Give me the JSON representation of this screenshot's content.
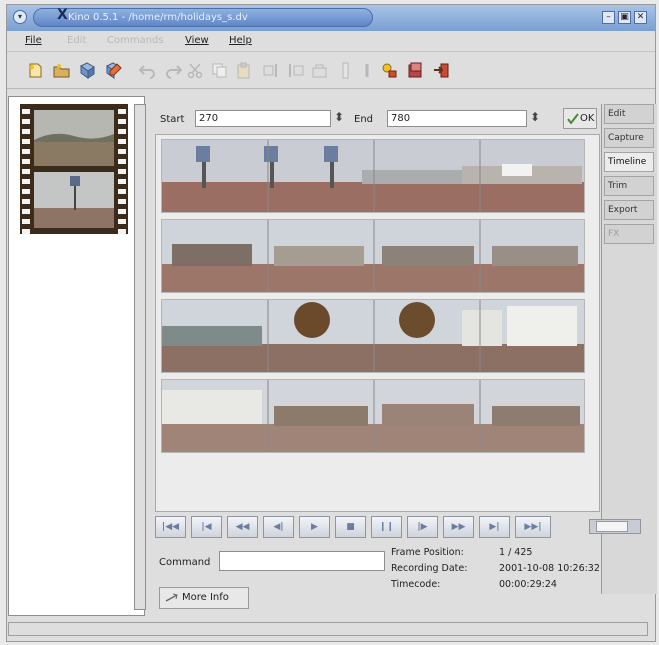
{
  "window": {
    "title": "Kino 0.5.1 - /home/rm/holidays_s.dv",
    "menu_glyph": "▾",
    "x_glyph": "X",
    "buttons": [
      "–",
      "▣",
      "✕"
    ]
  },
  "menubar": {
    "items": [
      {
        "label": "File",
        "enabled": true
      },
      {
        "label": "Edit",
        "enabled": false
      },
      {
        "label": "Commands",
        "enabled": false
      },
      {
        "label": "View",
        "enabled": true
      },
      {
        "label": "Help",
        "enabled": true
      }
    ]
  },
  "toolbar": {
    "icons": [
      "new-icon",
      "open-icon",
      "save-icon",
      "save-as-icon",
      "undo-icon",
      "redo-icon",
      "cut-icon",
      "copy-icon",
      "paste-icon",
      "insert-before-icon",
      "insert-after-icon",
      "append-icon",
      "split-icon",
      "join-icon",
      "properties-icon",
      "preferences-icon",
      "exit-icon"
    ]
  },
  "range": {
    "start_label": "Start",
    "start_value": "270",
    "end_label": "End",
    "end_value": "780",
    "spin_glyph": "⬍",
    "ok_label": "OK"
  },
  "tabs": [
    {
      "label": "Edit",
      "active": false,
      "enabled": true
    },
    {
      "label": "Capture",
      "active": false,
      "enabled": true
    },
    {
      "label": "Timeline",
      "active": true,
      "enabled": true
    },
    {
      "label": "Trim",
      "active": false,
      "enabled": true
    },
    {
      "label": "Export",
      "active": false,
      "enabled": true
    },
    {
      "label": "FX",
      "active": false,
      "enabled": false
    }
  ],
  "transport": {
    "buttons": [
      {
        "name": "start-of-movie",
        "glyph": "|◀◀"
      },
      {
        "name": "previous-scene",
        "glyph": "|◀"
      },
      {
        "name": "rewind",
        "glyph": "◀◀"
      },
      {
        "name": "back-frame",
        "glyph": "◀|"
      },
      {
        "name": "play",
        "glyph": "▶"
      },
      {
        "name": "stop",
        "glyph": "■"
      },
      {
        "name": "pause",
        "glyph": "❙❙"
      },
      {
        "name": "forward-frame",
        "glyph": "|▶"
      },
      {
        "name": "fast-forward",
        "glyph": "▶▶"
      },
      {
        "name": "next-scene",
        "glyph": "▶|"
      },
      {
        "name": "end-of-movie",
        "glyph": "▶▶|"
      }
    ]
  },
  "info": {
    "command_label": "Command",
    "command_value": "",
    "more_info_label": "More Info",
    "frame_position_label": "Frame Position:",
    "frame_position_value": "1 / 425",
    "recording_date_label": "Recording Date:",
    "recording_date_value": "2001-10-08 10:26:32",
    "timecode_label": "Timecode:",
    "timecode_value": "00:00:29:24"
  },
  "colors": {
    "titlebar": "#7a9fd2",
    "window_bg": "#dedede",
    "accent": "#6b7ea0"
  }
}
